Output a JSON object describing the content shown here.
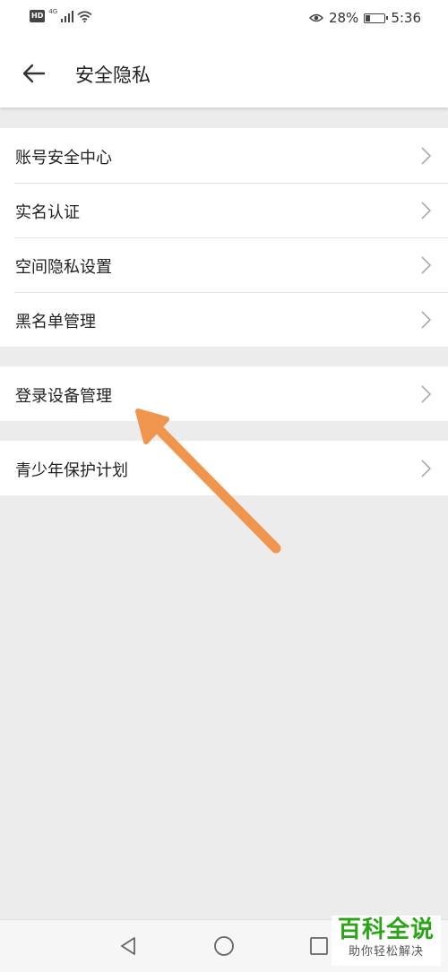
{
  "status_bar": {
    "hd_badge": "HD",
    "network": "4G",
    "battery": "28%",
    "battery_level": 0.28,
    "time": "5:36",
    "icons": [
      "signal-icon",
      "wifi-icon",
      "eye-icon",
      "battery-icon"
    ]
  },
  "header": {
    "title": "安全隐私",
    "back_icon": "back-arrow-icon"
  },
  "groups": [
    {
      "items": [
        {
          "label": "账号安全中心"
        },
        {
          "label": "实名认证"
        },
        {
          "label": "空间隐私设置"
        },
        {
          "label": "黑名单管理"
        }
      ]
    },
    {
      "items": [
        {
          "label": "登录设备管理"
        }
      ]
    },
    {
      "items": [
        {
          "label": "青少年保护计划"
        }
      ]
    }
  ],
  "annotation": {
    "type": "arrow",
    "color": "#f0954e"
  },
  "nav_bar": {
    "buttons": [
      "back-triangle-icon",
      "home-circle-icon",
      "recents-square-icon"
    ]
  },
  "watermark": {
    "title": "百科全说",
    "subtitle": "助你轻松解决",
    "color": "#2aa515"
  }
}
